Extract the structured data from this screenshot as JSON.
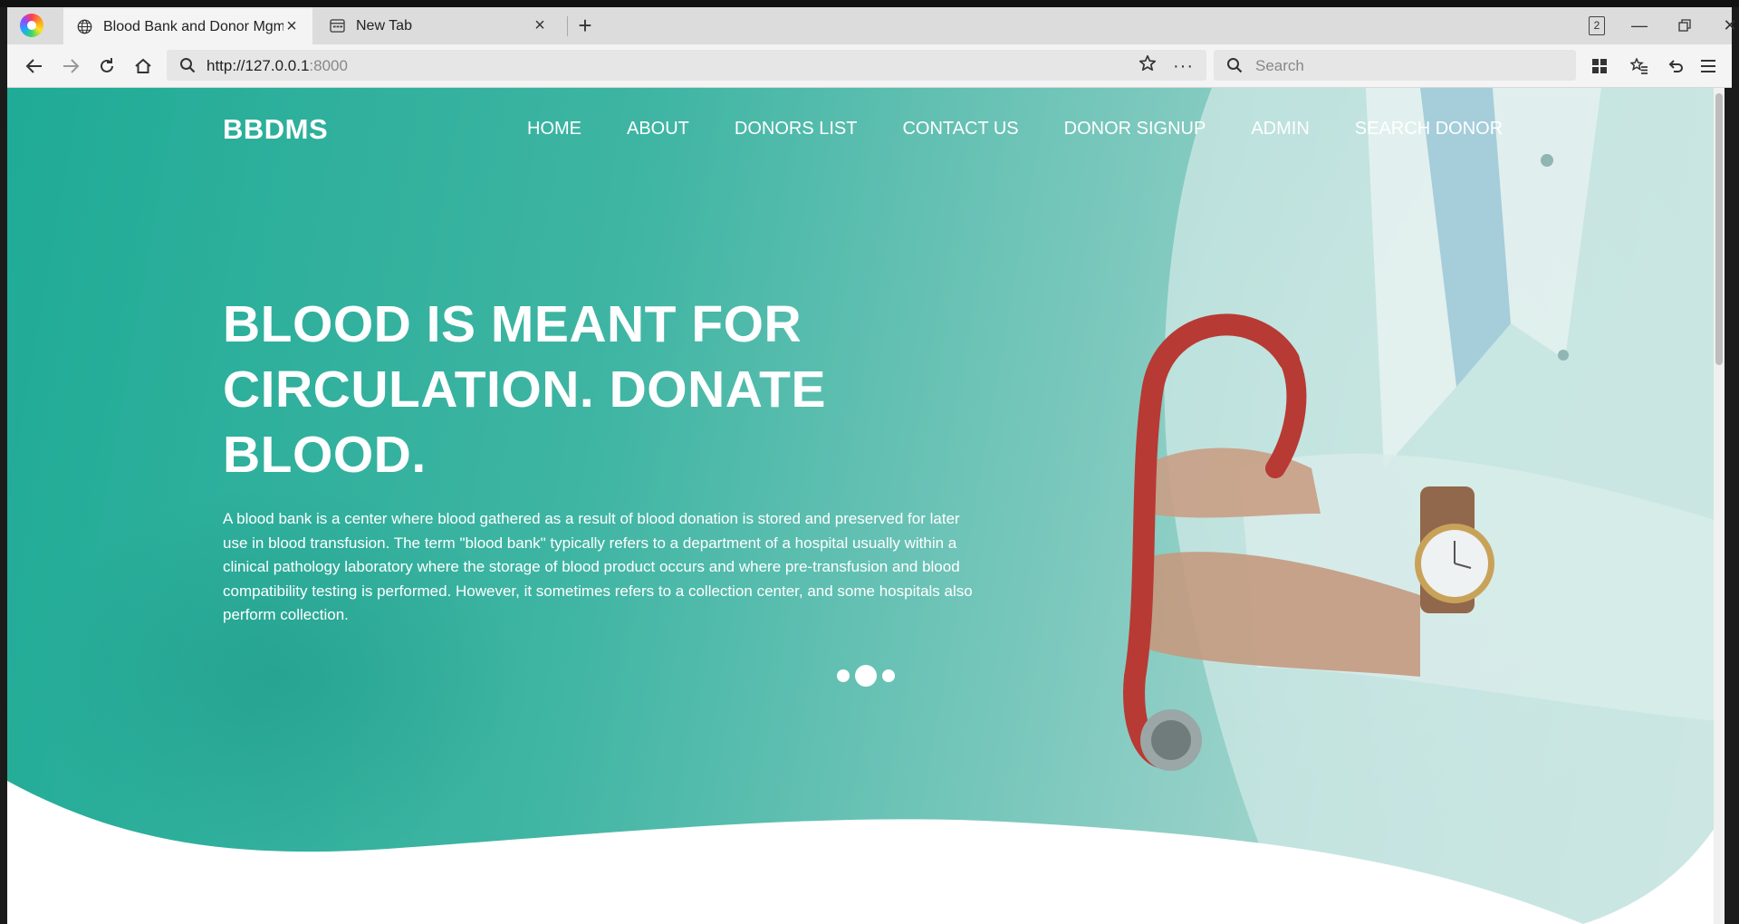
{
  "browser": {
    "tabs": [
      {
        "title": "Blood Bank and Donor Mgmt",
        "icon": "globe-icon",
        "active": true
      },
      {
        "title": "New Tab",
        "icon": "newtab-page-icon",
        "active": false
      }
    ],
    "new_tab_symbol": "+",
    "tab_count": "2",
    "address": {
      "host": "http://127.0.0.1",
      "port": ":8000"
    },
    "search": {
      "placeholder": "Search"
    }
  },
  "site": {
    "brand": "BBDMS",
    "menu": [
      "HOME",
      "ABOUT",
      "DONORS LIST",
      "CONTACT US",
      "DONOR SIGNUP",
      "ADMIN",
      "SEARCH DONOR"
    ],
    "headline": "BLOOD IS MEANT FOR CIRCULATION. DONATE BLOOD.",
    "description": "A blood bank is a center where blood gathered as a result of blood donation is stored and preserved for later use in blood transfusion. The term \"blood bank\" typically refers to a department of a hospital usually within a clinical pathology laboratory where the storage of blood product occurs and where pre-transfusion and blood compatibility testing is performed. However, it sometimes refers to a collection center, and some hospitals also perform collection.",
    "slider": {
      "slides": 3,
      "active_index": 1
    }
  },
  "colors": {
    "hero_teal": "#1fab96",
    "hero_light": "#c3e1dd",
    "text_on_hero": "#ffffff"
  }
}
